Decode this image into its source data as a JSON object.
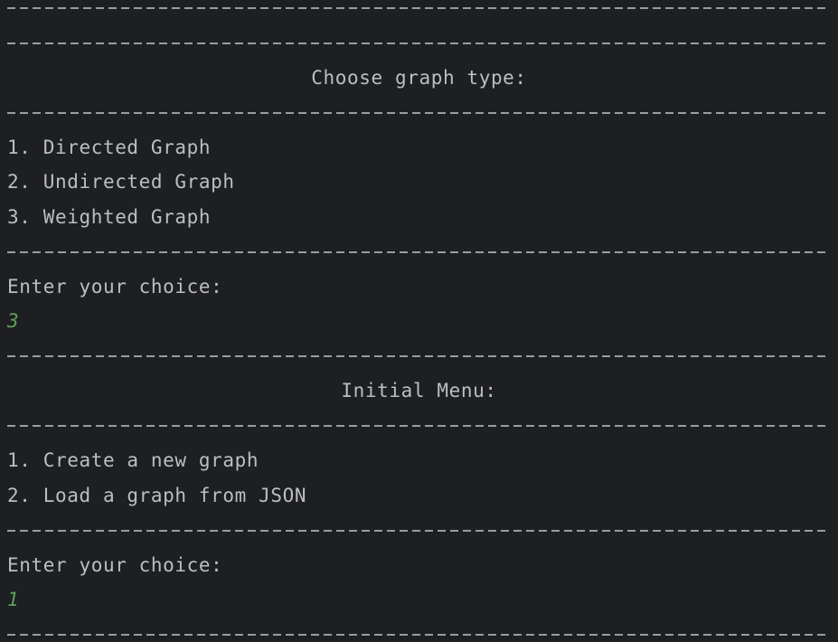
{
  "graph_type_menu": {
    "title": "Choose graph type:",
    "options": [
      "1. Directed Graph",
      "2. Undirected Graph",
      "3. Weighted Graph"
    ],
    "prompt": "Enter your choice:",
    "input": "3"
  },
  "initial_menu": {
    "title": "Initial Menu:",
    "options": [
      "1. Create a new graph",
      "2. Load a graph from JSON"
    ],
    "prompt": "Enter your choice:",
    "input": "1"
  },
  "colors": {
    "background": "#1e1f22",
    "text": "#bcbec4",
    "user_input": "#5fa05a"
  }
}
